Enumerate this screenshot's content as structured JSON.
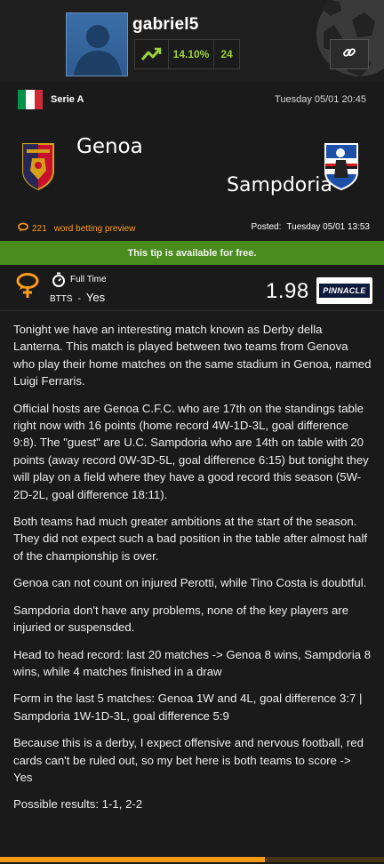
{
  "profile": {
    "username": "gabriel5",
    "yield": "14.10%",
    "tips_count": "24",
    "trend_icon": "trend-up-icon",
    "link_icon": "link-icon"
  },
  "league": {
    "flag": "italy-flag",
    "flag_colors": [
      "#009246",
      "#ffffff",
      "#ce2b37"
    ],
    "name": "Serie A",
    "date": "Tuesday 05/01 20:45"
  },
  "match": {
    "home_team": "Genoa",
    "away_team": "Sampdoria"
  },
  "preview": {
    "word_count": "221",
    "label": "word betting preview",
    "posted_label": "Posted:",
    "posted_date": "Tuesday 05/01 13:53"
  },
  "free_banner": "This tip is available for free.",
  "tip": {
    "period": "Full Time",
    "market": "BTTS",
    "separator": "-",
    "pick": "Yes",
    "odds": "1.98",
    "bookmaker": "PINNACLE"
  },
  "article": [
    "Tonight we have an interesting match known as Derby della Lanterna. This match is played between two teams from Genova who play their home matches on the same stadium in Genoa, named Luigi Ferraris.",
    "Official hosts are Genoa C.F.C. who are 17th on the standings table right now with 16 points (home record 4W-1D-3L, goal difference 9:8). The \"guest\" are U.C. Sampdoria who are 14th on table with 20 points (away record 0W-3D-5L, goal difference 6:15) but tonight they will play on a field where they have a good record this season (5W-2D-2L, goal difference 18:11).",
    "Both teams had much greater ambitions at the start of the season. They did not expect such a bad position in the table after almost half of the championship is over.",
    "Genoa can not count on injured Perotti, while Tino Costa is doubtful.",
    "Sampdoria don't have any problems, none of the key players are injuried or suspensded.",
    "Head to head record: last 20 matches -> Genoa 8 wins, Sampdoria 8 wins, while 4 matches finished in a draw",
    "Form in the last 5 matches: Genoa 1W and 4L, goal difference 3:7 | Sampdoria 1W-1D-3L, goal difference 5:9",
    "Because this is a derby, I expect offensive and nervous football, red cards can't be ruled out, so my bet here is both teams to score -> Yes",
    "Possible results: 1-1, 2-2"
  ],
  "reading_progress": 0.69,
  "colors": {
    "accent_orange": "#ff9c1a",
    "free_green": "#4b8c1f",
    "stat_green": "#9bd33b"
  }
}
